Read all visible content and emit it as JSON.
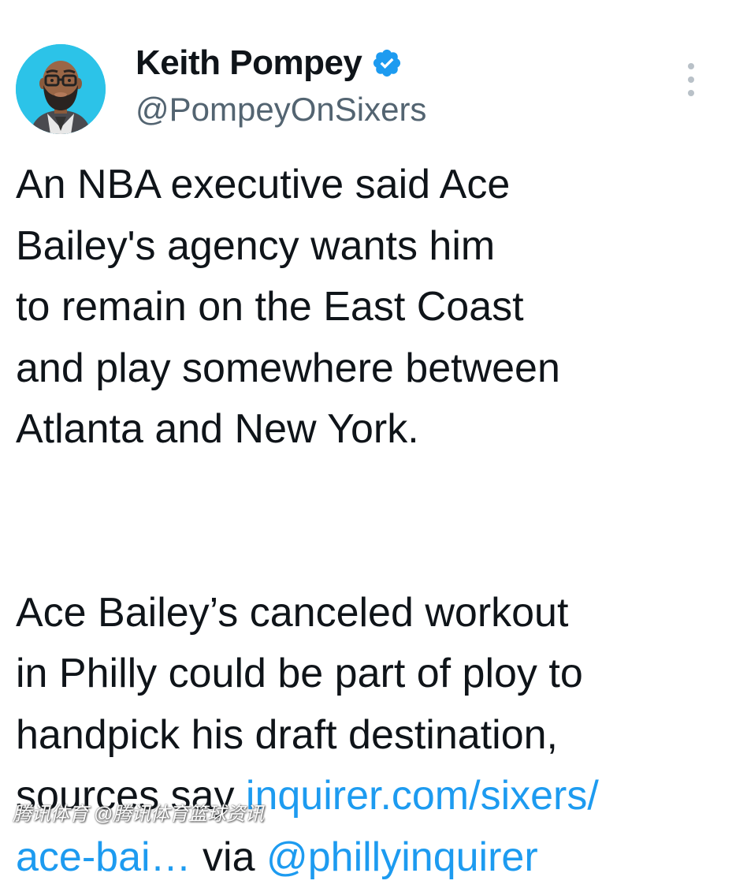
{
  "author": {
    "display_name": "Keith Pompey",
    "handle": "@PompeyOnSixers",
    "verified": true,
    "verified_icon": "verified-badge-icon",
    "avatar_icon": "bearded-man-avatar"
  },
  "menu": {
    "icon": "more-vertical-icon"
  },
  "tweet": {
    "paragraph1": [
      "An NBA executive said Ace",
      "Bailey's agency wants him",
      "to remain on the East Coast",
      "and play somewhere between",
      "Atlanta and New York."
    ],
    "paragraph2": [
      "Ace Bailey’s canceled workout",
      "in Philly could be part of ploy to",
      "handpick his draft destination,"
    ],
    "last_prefix": "sources say ",
    "link_part1": "inquirer.com/sixers/",
    "link_part2": "ace-bai…",
    "via_text": " via ",
    "mention": "@phillyinquirer"
  },
  "watermark": "腾讯体育 @腾讯体育篮球资讯",
  "colors": {
    "link": "#1d9bf0",
    "text": "#0f1419",
    "secondary": "#536471",
    "verified": "#1d9bf0",
    "avatar_bg": "#2cc3e8"
  }
}
